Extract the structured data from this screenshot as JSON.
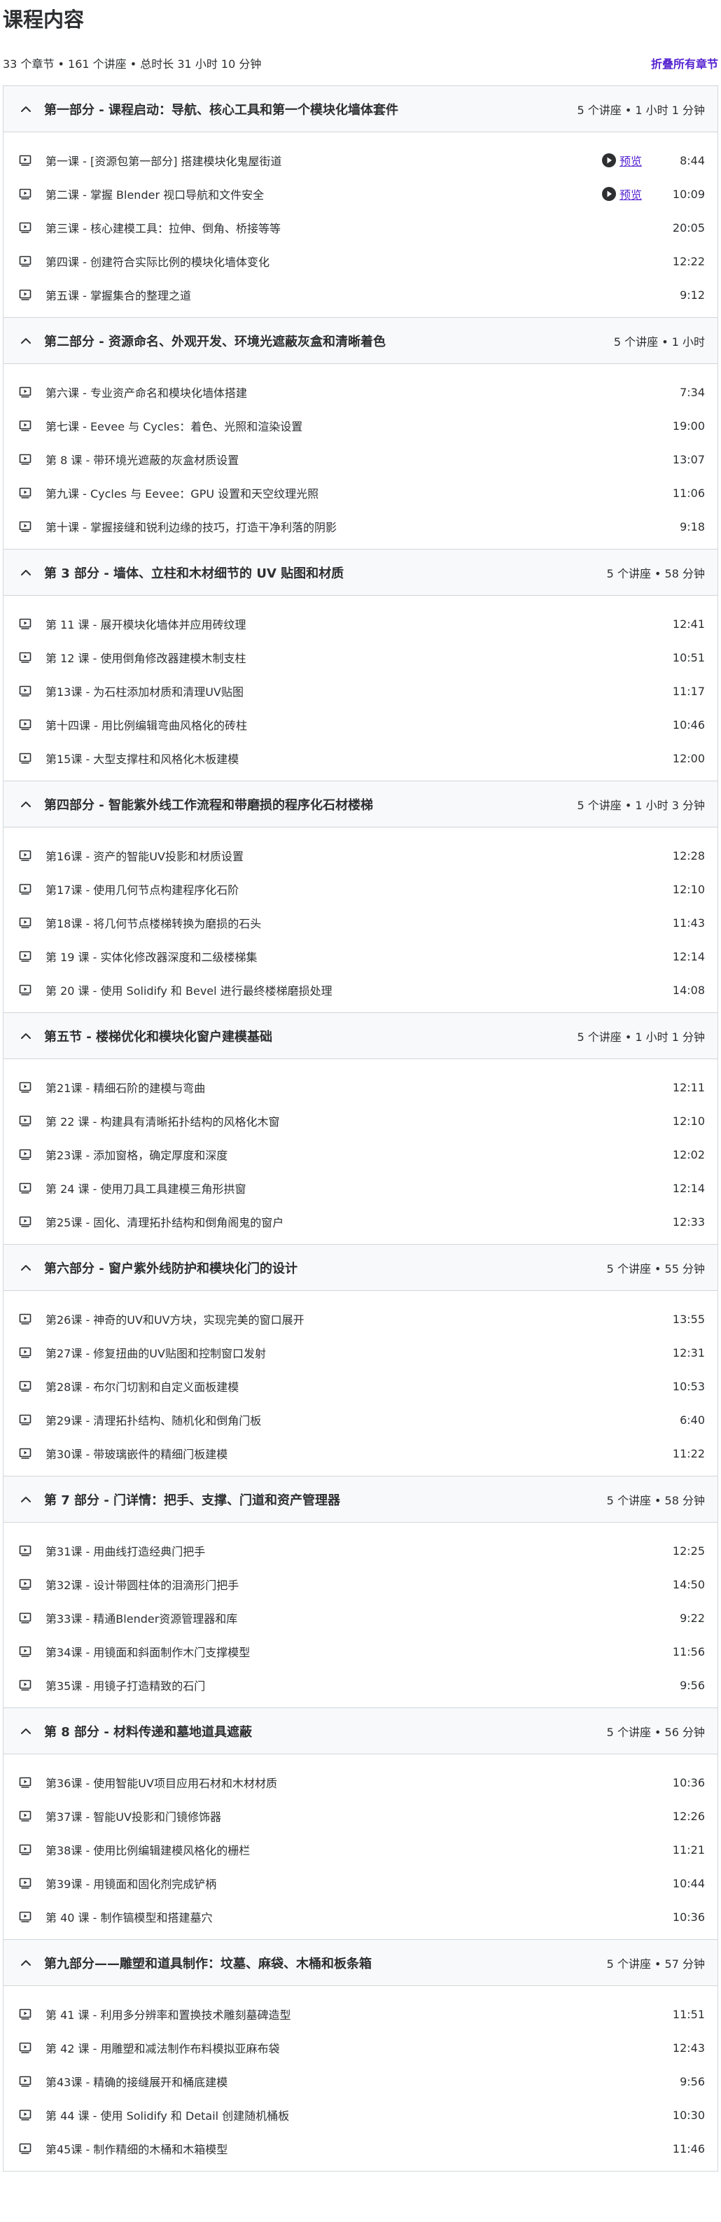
{
  "header": {
    "title": "课程内容",
    "summary": "33 个章节 • 161 个讲座 • 总时长 31 小时 10 分钟",
    "collapse_all": "折叠所有章节"
  },
  "preview_label": "预览",
  "sections": [
    {
      "title": "第一部分 - 课程启动：导航、核心工具和第一个模块化墙体套件",
      "meta": "5 个讲座 • 1 小时 1 分钟",
      "lectures": [
        {
          "title": "第一课 - [资源包第一部分] 搭建模块化鬼屋街道",
          "duration": "8:44",
          "preview": true
        },
        {
          "title": "第二课 - 掌握 Blender 视口导航和文件安全",
          "duration": "10:09",
          "preview": true
        },
        {
          "title": "第三课 - 核心建模工具：拉伸、倒角、桥接等等",
          "duration": "20:05",
          "preview": false
        },
        {
          "title": "第四课 - 创建符合实际比例的模块化墙体变化",
          "duration": "12:22",
          "preview": false
        },
        {
          "title": "第五课 - 掌握集合的整理之道",
          "duration": "9:12",
          "preview": false
        }
      ]
    },
    {
      "title": "第二部分 - 资源命名、外观开发、环境光遮蔽灰盒和清晰着色",
      "meta": "5 个讲座 • 1 小时",
      "lectures": [
        {
          "title": "第六课 - 专业资产命名和模块化墙体搭建",
          "duration": "7:34",
          "preview": false
        },
        {
          "title": "第七课 - Eevee 与 Cycles：着色、光照和渲染设置",
          "duration": "19:00",
          "preview": false
        },
        {
          "title": "第 8 课 - 带环境光遮蔽的灰盒材质设置",
          "duration": "13:07",
          "preview": false
        },
        {
          "title": "第九课 - Cycles 与 Eevee：GPU 设置和天空纹理光照",
          "duration": "11:06",
          "preview": false
        },
        {
          "title": "第十课 - 掌握接缝和锐利边缘的技巧，打造干净利落的阴影",
          "duration": "9:18",
          "preview": false
        }
      ]
    },
    {
      "title": "第 3 部分 - 墙体、立柱和木材细节的 UV 贴图和材质",
      "meta": "5 个讲座 • 58 分钟",
      "lectures": [
        {
          "title": "第 11 课 - 展开模块化墙体并应用砖纹理",
          "duration": "12:41",
          "preview": false
        },
        {
          "title": "第 12 课 - 使用倒角修改器建模木制支柱",
          "duration": "10:51",
          "preview": false
        },
        {
          "title": "第13课 - 为石柱添加材质和清理UV贴图",
          "duration": "11:17",
          "preview": false
        },
        {
          "title": "第十四课 - 用比例编辑弯曲风格化的砖柱",
          "duration": "10:46",
          "preview": false
        },
        {
          "title": "第15课 - 大型支撑柱和风格化木板建模",
          "duration": "12:00",
          "preview": false
        }
      ]
    },
    {
      "title": "第四部分 - 智能紫外线工作流程和带磨损的程序化石材楼梯",
      "meta": "5 个讲座 • 1 小时 3 分钟",
      "lectures": [
        {
          "title": "第16课 - 资产的智能UV投影和材质设置",
          "duration": "12:28",
          "preview": false
        },
        {
          "title": "第17课 - 使用几何节点构建程序化石阶",
          "duration": "12:10",
          "preview": false
        },
        {
          "title": "第18课 - 将几何节点楼梯转换为磨损的石头",
          "duration": "11:43",
          "preview": false
        },
        {
          "title": "第 19 课 - 实体化修改器深度和二级楼梯集",
          "duration": "12:14",
          "preview": false
        },
        {
          "title": "第 20 课 - 使用 Solidify 和 Bevel 进行最终楼梯磨损处理",
          "duration": "14:08",
          "preview": false
        }
      ]
    },
    {
      "title": "第五节 - 楼梯优化和模块化窗户建模基础",
      "meta": "5 个讲座 • 1 小时 1 分钟",
      "lectures": [
        {
          "title": "第21课 - 精细石阶的建模与弯曲",
          "duration": "12:11",
          "preview": false
        },
        {
          "title": "第 22 课 - 构建具有清晰拓扑结构的风格化木窗",
          "duration": "12:10",
          "preview": false
        },
        {
          "title": "第23课 - 添加窗格，确定厚度和深度",
          "duration": "12:02",
          "preview": false
        },
        {
          "title": "第 24 课 - 使用刀具工具建模三角形拱窗",
          "duration": "12:14",
          "preview": false
        },
        {
          "title": "第25课 - 固化、清理拓扑结构和倒角阁鬼的窗户",
          "duration": "12:33",
          "preview": false
        }
      ]
    },
    {
      "title": "第六部分 - 窗户紫外线防护和模块化门的设计",
      "meta": "5 个讲座 • 55 分钟",
      "lectures": [
        {
          "title": "第26课 - 神奇的UV和UV方块，实现完美的窗口展开",
          "duration": "13:55",
          "preview": false
        },
        {
          "title": "第27课 - 修复扭曲的UV贴图和控制窗口发射",
          "duration": "12:31",
          "preview": false
        },
        {
          "title": "第28课 - 布尔门切割和自定义面板建模",
          "duration": "10:53",
          "preview": false
        },
        {
          "title": "第29课 - 清理拓扑结构、随机化和倒角门板",
          "duration": "6:40",
          "preview": false
        },
        {
          "title": "第30课 - 带玻璃嵌件的精细门板建模",
          "duration": "11:22",
          "preview": false
        }
      ]
    },
    {
      "title": "第 7 部分 - 门详情：把手、支撑、门道和资产管理器",
      "meta": "5 个讲座 • 58 分钟",
      "lectures": [
        {
          "title": "第31课 - 用曲线打造经典门把手",
          "duration": "12:25",
          "preview": false
        },
        {
          "title": "第32课 - 设计带圆柱体的泪滴形门把手",
          "duration": "14:50",
          "preview": false
        },
        {
          "title": "第33课 - 精通Blender资源管理器和库",
          "duration": "9:22",
          "preview": false
        },
        {
          "title": "第34课 - 用镜面和斜面制作木门支撑模型",
          "duration": "11:56",
          "preview": false
        },
        {
          "title": "第35课 - 用镜子打造精致的石门",
          "duration": "9:56",
          "preview": false
        }
      ]
    },
    {
      "title": "第 8 部分 - 材料传递和墓地道具遮蔽",
      "meta": "5 个讲座 • 56 分钟",
      "lectures": [
        {
          "title": "第36课 - 使用智能UV项目应用石材和木材材质",
          "duration": "10:36",
          "preview": false
        },
        {
          "title": "第37课 - 智能UV投影和门镜修饰器",
          "duration": "12:26",
          "preview": false
        },
        {
          "title": "第38课 - 使用比例编辑建模风格化的栅栏",
          "duration": "11:21",
          "preview": false
        },
        {
          "title": "第39课 - 用镜面和固化剂完成铲柄",
          "duration": "10:44",
          "preview": false
        },
        {
          "title": "第 40 课 - 制作镐模型和搭建墓穴",
          "duration": "10:36",
          "preview": false
        }
      ]
    },
    {
      "title": "第九部分——雕塑和道具制作：坟墓、麻袋、木桶和板条箱",
      "meta": "5 个讲座 • 57 分钟",
      "lectures": [
        {
          "title": "第 41 课 - 利用多分辨率和置换技术雕刻墓碑造型",
          "duration": "11:51",
          "preview": false
        },
        {
          "title": "第 42 课 - 用雕塑和减法制作布料模拟亚麻布袋",
          "duration": "12:43",
          "preview": false
        },
        {
          "title": "第43课 - 精确的接缝展开和桶底建模",
          "duration": "9:56",
          "preview": false
        },
        {
          "title": "第 44 课 - 使用 Solidify 和 Detail 创建随机桶板",
          "duration": "10:30",
          "preview": false
        },
        {
          "title": "第45课 - 制作精细的木桶和木箱模型",
          "duration": "11:46",
          "preview": false
        }
      ]
    }
  ]
}
